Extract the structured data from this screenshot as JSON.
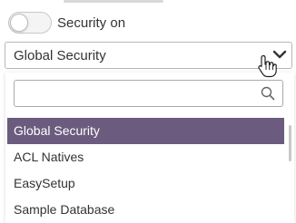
{
  "security_toggle": {
    "label": "Security on",
    "state": "off"
  },
  "security_select": {
    "selected_value": "Global Security"
  },
  "dropdown": {
    "search": {
      "value": "",
      "placeholder": ""
    },
    "options": [
      {
        "label": "Global Security",
        "selected": true
      },
      {
        "label": "ACL Natives",
        "selected": false
      },
      {
        "label": "EasySetup",
        "selected": false
      },
      {
        "label": "Sample Database",
        "selected": false
      }
    ]
  },
  "colors": {
    "selected_bg": "#6b5b7e",
    "selected_text": "#ffffff",
    "text": "#333333",
    "border": "#b8b8b8"
  },
  "icons": {
    "select_arrow": "chevron-down-icon",
    "search": "search-icon",
    "cursor": "hand-pointer-icon"
  }
}
